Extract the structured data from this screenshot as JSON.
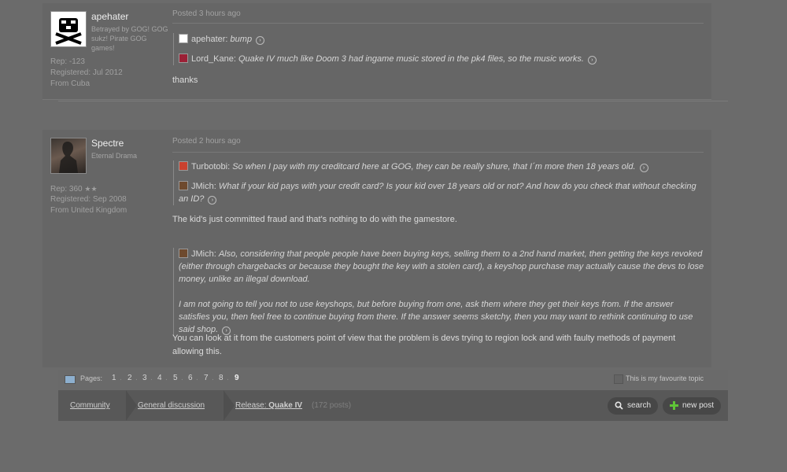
{
  "post1": {
    "user": {
      "name": "apehater",
      "title": "Betrayed by GOG! GOG sukz! Pirate GOG games!",
      "rep": "Rep: -123",
      "registered": "Registered: Jul 2012",
      "from": "From Cuba"
    },
    "posted": "Posted 3 hours ago",
    "quotes": [
      {
        "author": "apehater:",
        "text": "bump"
      },
      {
        "author": "Lord_Kane:",
        "text": "Quake IV much like Doom 3 had ingame music stored in the pk4 files, so the music works."
      }
    ],
    "body": "thanks"
  },
  "post2": {
    "user": {
      "name": "Spectre",
      "title": "Eternal Drama",
      "rep": "Rep: 360",
      "stars": "★★",
      "registered": "Registered: Sep 2008",
      "from": "From United Kingdom"
    },
    "posted": "Posted 2 hours ago",
    "quote1": [
      {
        "author": "Turbotobi:",
        "text": "So when I pay with my creditcard here at GOG, they can be really shure, that I´m more then 18 years old."
      },
      {
        "author": "JMich:",
        "text": "What if your kid pays with your credit card? Is your kid over 18 years old or not? And how do you check that without checking an ID?"
      }
    ],
    "body1": "The kid's just committed fraud and that's nothing to do with the gamestore.",
    "quote2": {
      "author": "JMich:",
      "para1": "Also, considering that people people have been buying keys, selling them to a 2nd hand market, then getting the keys revoked (either through chargebacks or because they bought the key with a stolen card), a keyshop purchase may actually cause the devs to lose money, unlike an illegal download.",
      "para2": "I am not going to tell you not to use keyshops, but before buying from one, ask them where they get their keys from. If the answer satisfies you, then feel free to continue buying from there. If the answer seems sketchy, then you may want to rethink continuing to use said shop."
    },
    "body2": "You can look at it from the customers point of view that the problem is devs trying to region lock and with faulty methods of payment allowing this."
  },
  "pager": {
    "label": "Pages:",
    "pages": [
      "1",
      "2",
      "3",
      "4",
      "5",
      "6",
      "7",
      "8",
      "9"
    ],
    "current": "9",
    "favourite": "This is my favourite topic"
  },
  "breadcrumb": {
    "community": "Community",
    "general": "General discussion",
    "release_prefix": "Release:",
    "release_title": "Quake IV",
    "post_count": "(172 posts)"
  },
  "buttons": {
    "search": "search",
    "new_post": "new post"
  },
  "icons": {
    "arrow": "circle-arrow-icon",
    "search": "magnifier-icon",
    "new_post": "plus-icon",
    "pages": "pages-icon"
  },
  "colors": {
    "background": "#6b6b6b",
    "post": "#666666",
    "bar": "#585858",
    "plus": "#5fc437"
  }
}
